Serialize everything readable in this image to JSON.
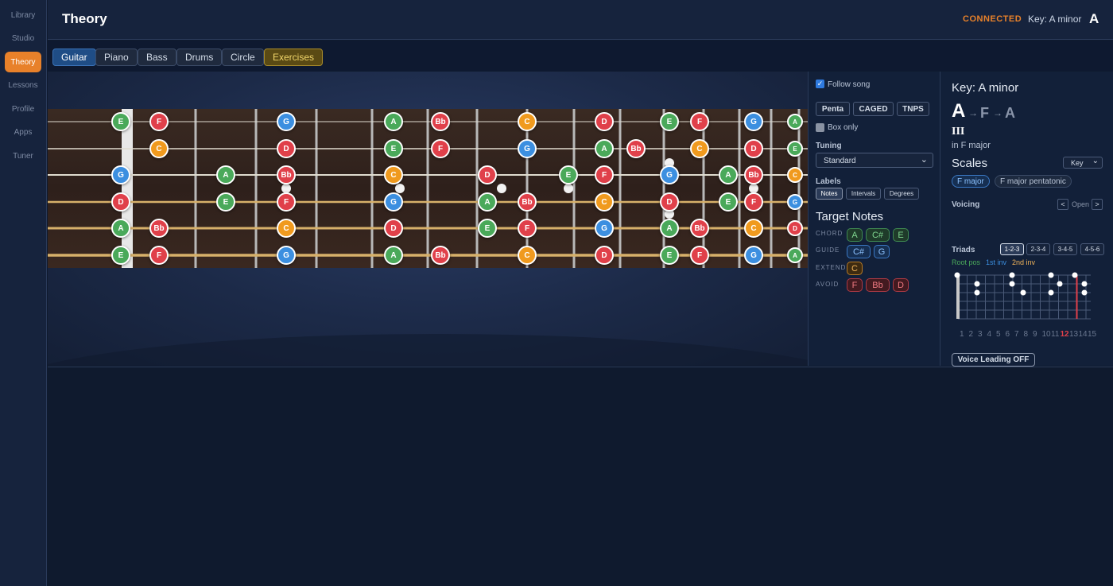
{
  "sidebar": {
    "items": [
      {
        "label": "Library",
        "active": false
      },
      {
        "label": "Studio",
        "active": false
      },
      {
        "label": "Theory",
        "active": true
      },
      {
        "label": "Lessons",
        "active": false
      },
      {
        "label": "Profile",
        "active": false
      },
      {
        "label": "Apps",
        "active": false
      },
      {
        "label": "Tuner",
        "active": false
      }
    ]
  },
  "header": {
    "title": "Theory",
    "status": "CONNECTED",
    "key_label": "Key: A minor",
    "key_short": "A"
  },
  "tabs": [
    {
      "label": "Guitar",
      "state": "active"
    },
    {
      "label": "Piano",
      "state": "normal"
    },
    {
      "label": "Bass",
      "state": "normal"
    },
    {
      "label": "Drums",
      "state": "normal"
    },
    {
      "label": "Circle",
      "state": "normal"
    },
    {
      "label": "Exercises",
      "state": "highlight"
    }
  ],
  "fretboard": {
    "colors": {
      "A": "#4aa95a",
      "E": "#4aa95a",
      "C": "#f09a1e",
      "G": "#3c8fe0",
      "D": "#e0404a",
      "F": "#e0404a",
      "Bb": "#e0404a"
    },
    "strings": [
      {
        "notes": [
          "E",
          "F",
          "G",
          "A",
          "Bb",
          "C",
          "D",
          "E",
          "F",
          "G",
          "A"
        ]
      },
      {
        "notes": [
          "C",
          "D",
          "E",
          "F",
          "G",
          "A",
          "Bb",
          "C",
          "D",
          "E"
        ]
      },
      {
        "notes": [
          "G",
          "A",
          "Bb",
          "C",
          "D",
          "E",
          "F",
          "G",
          "A",
          "Bb",
          "C"
        ]
      },
      {
        "notes": [
          "D",
          "E",
          "F",
          "G",
          "A",
          "Bb",
          "C",
          "D",
          "E",
          "F",
          "G"
        ]
      },
      {
        "notes": [
          "A",
          "Bb",
          "C",
          "D",
          "E",
          "F",
          "G",
          "A",
          "Bb",
          "C",
          "D"
        ]
      },
      {
        "notes": [
          "E",
          "F",
          "G",
          "A",
          "Bb",
          "C",
          "D",
          "E",
          "F",
          "G",
          "A"
        ]
      }
    ]
  },
  "controls": {
    "follow_song": "Follow song",
    "follow_checked": true,
    "shape_buttons": [
      "Penta",
      "CAGED",
      "TNPS"
    ],
    "box_only": "Box only",
    "tuning_label": "Tuning",
    "tuning_value": "Standard",
    "labels_label": "Labels",
    "label_options": [
      {
        "label": "Notes",
        "active": true
      },
      {
        "label": "Intervals",
        "active": false
      },
      {
        "label": "Degrees",
        "active": false
      }
    ],
    "target_title": "Target Notes",
    "chord_label": "CHORD",
    "chord_notes": [
      "A",
      "C#",
      "E"
    ],
    "guide_label": "GUIDE",
    "guide_notes": [
      "C#",
      "G"
    ],
    "extend_label": "EXTEND",
    "extend_notes": [
      "C"
    ],
    "avoid_label": "AVOID",
    "avoid_notes": [
      "F",
      "Bb",
      "D"
    ]
  },
  "right": {
    "key_title": "Key: A minor",
    "progression": [
      "A",
      "F",
      "A"
    ],
    "numeral": "III",
    "context": "in F major",
    "scales_title": "Scales",
    "scales_select": "Key",
    "scale_chips": [
      {
        "label": "F major",
        "active": true
      },
      {
        "label": "F major pentatonic",
        "active": false
      }
    ],
    "voicing_label": "Voicing",
    "voicing_value": "Open",
    "triads_label": "Triads",
    "triad_sets": [
      {
        "label": "1-2-3",
        "active": true
      },
      {
        "label": "2-3-4",
        "active": false
      },
      {
        "label": "3-4-5",
        "active": false
      },
      {
        "label": "4-5-6",
        "active": false
      }
    ],
    "inversion_legend": [
      {
        "label": "Root pos",
        "color": "#4aa95a"
      },
      {
        "label": "1st inv",
        "color": "#3c8fe0"
      },
      {
        "label": "2nd inv",
        "color": "#f0b35a"
      }
    ],
    "fret_numbers": [
      "1",
      "2",
      "3",
      "4",
      "5",
      "6",
      "7",
      "8",
      "9",
      "10",
      "11",
      "12",
      "13",
      "14",
      "15"
    ],
    "highlight_fret": "12",
    "voice_leading": "Voice Leading OFF"
  }
}
